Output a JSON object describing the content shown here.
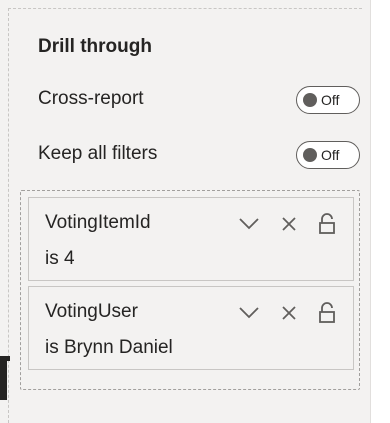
{
  "drill_through": {
    "title": "Drill through",
    "cross_report": {
      "label": "Cross-report",
      "state": "Off"
    },
    "keep_all_filters": {
      "label": "Keep all filters",
      "state": "Off"
    }
  },
  "filters": [
    {
      "name": "VotingItemId",
      "value": "is 4"
    },
    {
      "name": "VotingUser",
      "value": "is Brynn Daniel"
    }
  ],
  "icons": {
    "expand": "chevron-down-icon",
    "remove": "close-icon",
    "lock": "lock-icon"
  }
}
